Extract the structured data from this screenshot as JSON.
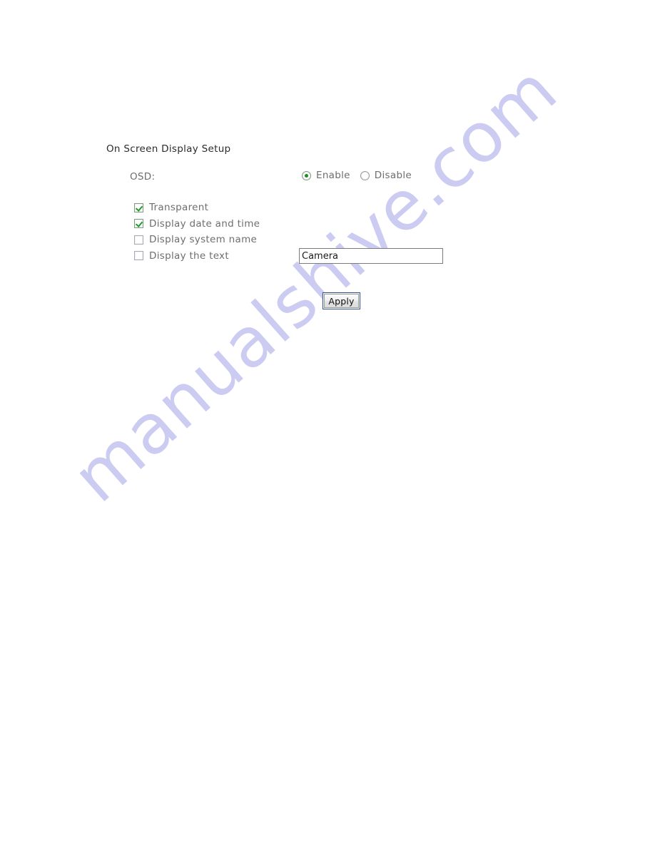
{
  "page": {
    "title": "On Screen Display Setup",
    "background_color": "#ffffff"
  },
  "watermark": {
    "text": "manualshive.com",
    "color": "#ccccf2",
    "rotation_deg": -41.5
  },
  "osd": {
    "label": "OSD:",
    "radio_options": [
      {
        "label": "Enable",
        "selected": true
      },
      {
        "label": "Disable",
        "selected": false
      }
    ],
    "selected_value": "Enable",
    "accent_color": "#1f8a1f"
  },
  "checkboxes": [
    {
      "label": "Transparent",
      "checked": true
    },
    {
      "label": "Display date and time",
      "checked": true
    },
    {
      "label": "Display system name",
      "checked": false
    },
    {
      "label": "Display the text",
      "checked": false
    }
  ],
  "text_field": {
    "value": "Camera",
    "placeholder": ""
  },
  "apply_button": {
    "label": "Apply",
    "border_color": "#2d4f8e"
  }
}
